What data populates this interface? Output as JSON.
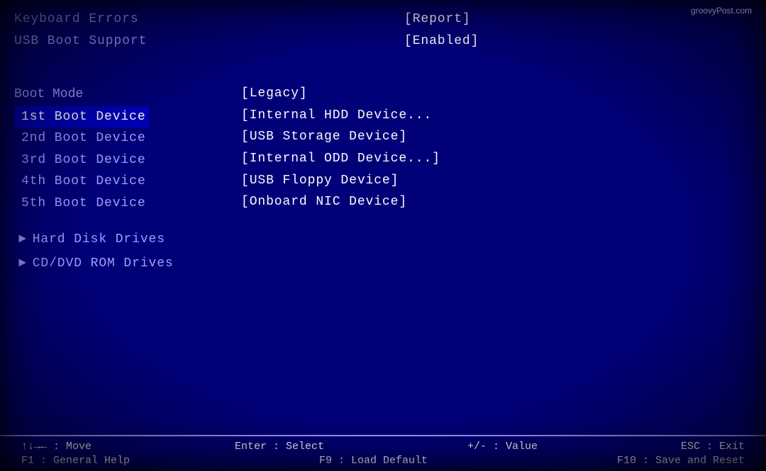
{
  "watermark": "groovyPost.com",
  "top": {
    "keyboard_errors_label": "Keyboard Errors",
    "keyboard_errors_value": "[Report]",
    "usb_boot_label": "USB Boot Support",
    "usb_boot_value": "[Enabled]"
  },
  "boot": {
    "boot_mode_label": "Boot Mode",
    "boot_mode_value": "[Legacy]",
    "devices": [
      {
        "label": "1st Boot Device",
        "value": "[Internal HDD Device...",
        "highlighted": true
      },
      {
        "label": "2nd Boot Device",
        "value": "[USB Storage Device]",
        "highlighted": false
      },
      {
        "label": "3rd Boot Device",
        "value": "[Internal ODD Device...]",
        "highlighted": false
      },
      {
        "label": "4th Boot Device",
        "value": "[USB Floppy Device]",
        "highlighted": false
      },
      {
        "label": "5th Boot Device",
        "value": "[Onboard NIC Device]",
        "highlighted": false
      }
    ],
    "submenus": [
      "Hard Disk Drives",
      "CD/DVD ROM Drives"
    ]
  },
  "footer": {
    "row1": [
      {
        "key": "↑↓→← : Move",
        "desc": ""
      },
      {
        "key": "Enter : Select",
        "desc": ""
      },
      {
        "key": "+/- : Value",
        "desc": ""
      },
      {
        "key": "ESC : Exit",
        "desc": ""
      }
    ],
    "row2": [
      {
        "key": "F1 : General Help",
        "desc": ""
      },
      {
        "key": "F9 : Load Default",
        "desc": ""
      },
      {
        "key": "F10 : Save and Reset",
        "desc": ""
      }
    ]
  }
}
